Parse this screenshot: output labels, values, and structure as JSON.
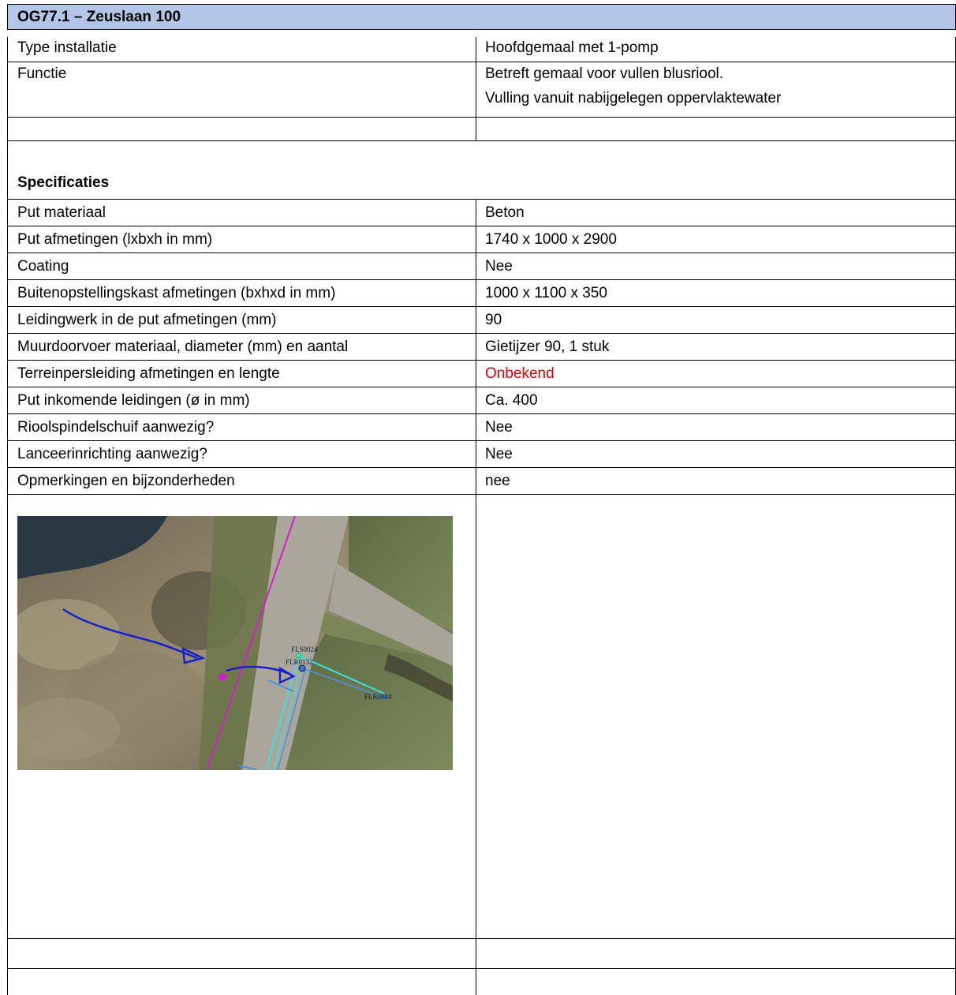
{
  "title": "OG77.1 – Zeuslaan 100",
  "general": [
    {
      "label": "Type installatie",
      "value": "Hoofdgemaal met 1-pomp"
    },
    {
      "label": "Functie",
      "value": "Betreft gemaal voor vullen blusriool.",
      "value2": "Vulling vanuit nabijgelegen oppervlaktewater"
    }
  ],
  "spec_heading": "Specificaties",
  "specs": [
    {
      "label": "Put materiaal",
      "value": "Beton"
    },
    {
      "label": "Put afmetingen (lxbxh in mm)",
      "value": "1740 x 1000 x 2900"
    },
    {
      "label": "Coating",
      "value": "Nee"
    },
    {
      "label": "Buitenopstellingskast afmetingen (bxhxd in mm)",
      "value": "1000 x 1100 x 350"
    },
    {
      "label": "Leidingwerk in de put afmetingen (mm)",
      "value": "90"
    },
    {
      "label": "Muurdoorvoer materiaal, diameter (mm) en aantal",
      "value": "Gietijzer 90, 1 stuk"
    },
    {
      "label": "Terreinpersleiding afmetingen en lengte",
      "value": "Onbekend"
    },
    {
      "label": "Put inkomende leidingen (ø in mm)",
      "value": "Ca. 400"
    },
    {
      "label": "Rioolspindelschuif aanwezig?",
      "value": "Nee"
    },
    {
      "label": "Lanceerinrichting aanwezig?",
      "value": "Nee"
    },
    {
      "label": "Opmerkingen en bijzonderheden",
      "value": "nee"
    }
  ],
  "map": {
    "labels": [
      "FLS0024",
      "FLR0132",
      "FLR0004"
    ],
    "colors": {
      "water": "#2c3a45",
      "grass": "#6f7d52",
      "road": "#a9a59c",
      "pink": "#d020c8",
      "blue": "#2030c0",
      "cyan": "#40e0e0"
    }
  },
  "colors": {
    "header_bg": "#b4c6e7",
    "alert": "#e00000"
  }
}
